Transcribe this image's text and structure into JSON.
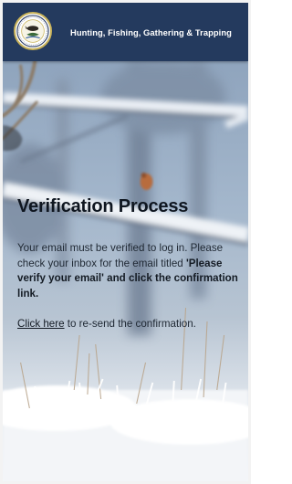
{
  "header": {
    "title": "Hunting, Fishing, Gathering & Trapping",
    "logo_icon": "agency-seal-icon",
    "background_color": "#243a5e"
  },
  "verification": {
    "heading": "Verification Process",
    "message_intro": "Your email must be verified to log in. Please check your inbox for the email titled",
    "email_subject": "'Please verify your email'",
    "message_and": "and",
    "message_action": "click the confirmation link.",
    "resend_link": "Click here",
    "resend_suffix": " to re-send the confirmation."
  }
}
